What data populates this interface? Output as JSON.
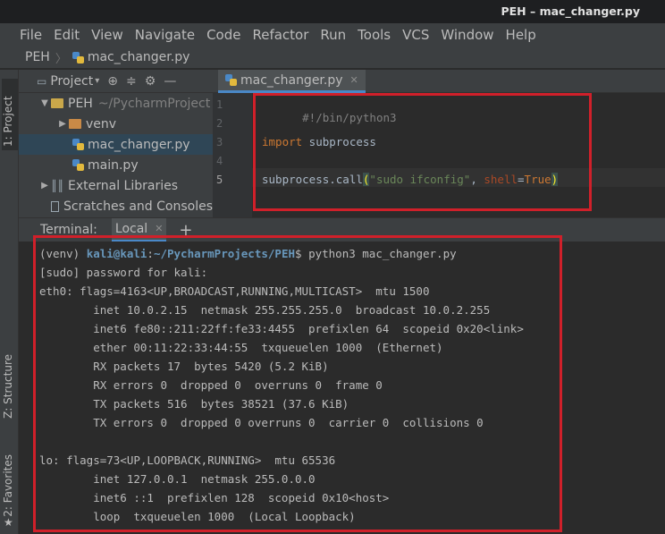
{
  "window": {
    "title": "PEH – mac_changer.py"
  },
  "menu": [
    "File",
    "Edit",
    "View",
    "Navigate",
    "Code",
    "Refactor",
    "Run",
    "Tools",
    "VCS",
    "Window",
    "Help"
  ],
  "breadcrumb": {
    "project": "PEH",
    "file": "mac_changer.py"
  },
  "side_tabs": {
    "project": "1: Project",
    "structure": "Z: Structure",
    "favorites": "2: Favorites"
  },
  "project_panel": {
    "title": "Project",
    "tree": [
      {
        "label": "PEH",
        "suffix": "~/PycharmProject",
        "kind": "folder",
        "expanded": true
      },
      {
        "label": "venv",
        "kind": "folder-orange",
        "expanded": false
      },
      {
        "label": "mac_changer.py",
        "kind": "python",
        "selected": true
      },
      {
        "label": "main.py",
        "kind": "python"
      },
      {
        "label": "External Libraries",
        "kind": "library"
      },
      {
        "label": "Scratches and Consoles",
        "kind": "scratch"
      }
    ]
  },
  "editor": {
    "tab": "mac_changer.py",
    "line_numbers": [
      "1",
      "2",
      "3",
      "4",
      "5"
    ],
    "code": {
      "line1": "#!/bin/python3",
      "line3_kw": "import",
      "line3_rest": " subprocess",
      "line5_call": "subprocess.call",
      "line5_open": "(",
      "line5_str": "\"sudo ifconfig\"",
      "line5_comma": ", ",
      "line5_param": "shell",
      "line5_eq": "=",
      "line5_const": "True",
      "line5_close": ")"
    }
  },
  "terminal": {
    "label": "Terminal:",
    "tab": "Local",
    "prompt": {
      "venv": "(venv) ",
      "userhost": "kali@kali",
      "colon": ":",
      "path": "~/PycharmProjects/PEH",
      "dollar": "$ ",
      "command": "python3 mac_changer.py"
    },
    "lines": [
      "[sudo] password for kali:",
      "eth0: flags=4163<UP,BROADCAST,RUNNING,MULTICAST>  mtu 1500",
      "        inet 10.0.2.15  netmask 255.255.255.0  broadcast 10.0.2.255",
      "        inet6 fe80::211:22ff:fe33:4455  prefixlen 64  scopeid 0x20<link>",
      "        ether 00:11:22:33:44:55  txqueuelen 1000  (Ethernet)",
      "        RX packets 17  bytes 5420 (5.2 KiB)",
      "        RX errors 0  dropped 0  overruns 0  frame 0",
      "        TX packets 516  bytes 38521 (37.6 KiB)",
      "        TX errors 0  dropped 0 overruns 0  carrier 0  collisions 0",
      "",
      "lo: flags=73<UP,LOOPBACK,RUNNING>  mtu 65536",
      "        inet 127.0.0.1  netmask 255.0.0.0",
      "        inet6 ::1  prefixlen 128  scopeid 0x10<host>",
      "        loop  txqueuelen 1000  (Local Loopback)"
    ]
  },
  "colors": {
    "annotation_red": "#d0202a",
    "accent": "#4a88c7"
  }
}
